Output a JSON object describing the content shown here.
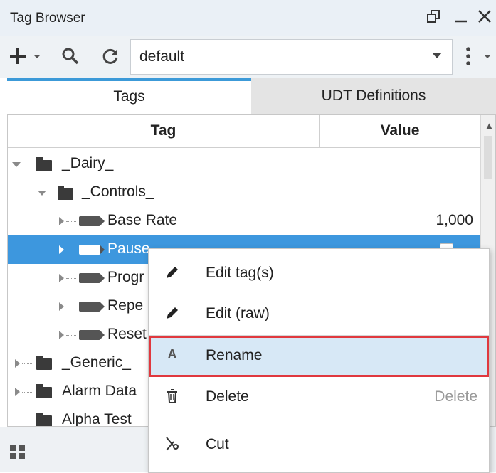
{
  "window": {
    "title": "Tag Browser"
  },
  "toolbar": {
    "provider_value": "default"
  },
  "tabs": [
    {
      "label": "Tags"
    },
    {
      "label": "UDT Definitions"
    }
  ],
  "tree": {
    "columns": {
      "tag": "Tag",
      "value": "Value"
    },
    "rows": [
      {
        "label": "_Dairy_",
        "value": ""
      },
      {
        "label": "_Controls_",
        "value": ""
      },
      {
        "label": "Base Rate",
        "value": "1,000"
      },
      {
        "label": "Pause",
        "value": ""
      },
      {
        "label": "Progr",
        "value": ""
      },
      {
        "label": "Repe",
        "value": ""
      },
      {
        "label": "Reset",
        "value": ""
      },
      {
        "label": "_Generic_",
        "value": ""
      },
      {
        "label": "Alarm Data",
        "value": ""
      },
      {
        "label": "Alpha Test",
        "value": ""
      }
    ]
  },
  "context_menu": {
    "items": [
      {
        "label": "Edit tag(s)",
        "icon": "pencil-icon",
        "shortcut": ""
      },
      {
        "label": "Edit (raw)",
        "icon": "pencil-icon",
        "shortcut": ""
      },
      {
        "label": "Rename",
        "icon": "letter-a-icon",
        "icon_glyph": "A",
        "shortcut": ""
      },
      {
        "label": "Delete",
        "icon": "trash-icon",
        "shortcut": "Delete"
      },
      {
        "label": "Cut",
        "icon": "scissors-icon",
        "shortcut": ""
      }
    ]
  },
  "colors": {
    "accent": "#3c9ad8",
    "selection": "#3d97de",
    "highlight_border": "#e0383e",
    "highlight_fill": "#d7e8f6"
  }
}
